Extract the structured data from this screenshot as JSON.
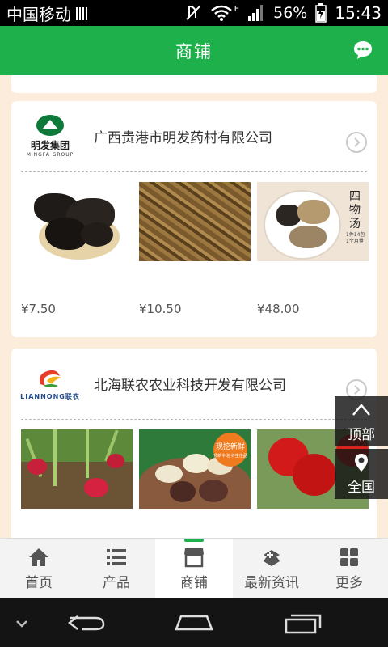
{
  "status_bar": {
    "carrier": "中国移动",
    "battery_percent": "56%",
    "time": "15:43",
    "network_label": "E"
  },
  "header": {
    "title": "商铺",
    "chat_icon": "chat-bubble-icon"
  },
  "shops": [
    {
      "name": "广西贵港市明发药村有限公司",
      "logo_text_cn": "明发集团",
      "logo_text_en": "MINGFA GROUP",
      "products": [
        {
          "price": "¥7.50"
        },
        {
          "price": "¥10.50"
        },
        {
          "price": "¥48.00"
        }
      ]
    },
    {
      "name": "北海联农农业科技开发有限公司",
      "logo_text_en": "LIANNONG联农",
      "products": [
        {
          "price": ""
        },
        {
          "price": ""
        },
        {
          "price": ""
        }
      ]
    }
  ],
  "product_overlays": {
    "siwutang_text": "四物汤",
    "siwutang_sub": "1件14包 1个月量",
    "fresh_badge_main": "现挖新鲜",
    "fresh_badge_sub": "顶新丰泡 养生佳品"
  },
  "floating": {
    "top_label": "顶部",
    "region_label": "全国"
  },
  "tabs": [
    {
      "label": "首页",
      "icon": "home-icon",
      "active": false
    },
    {
      "label": "产品",
      "icon": "list-icon",
      "active": false
    },
    {
      "label": "商铺",
      "icon": "shop-icon",
      "active": true
    },
    {
      "label": "最新资讯",
      "icon": "news-icon",
      "active": false
    },
    {
      "label": "更多",
      "icon": "grid-icon",
      "active": false
    }
  ],
  "colors": {
    "brand_green": "#1eb04a",
    "page_background": "#fbecdb"
  }
}
